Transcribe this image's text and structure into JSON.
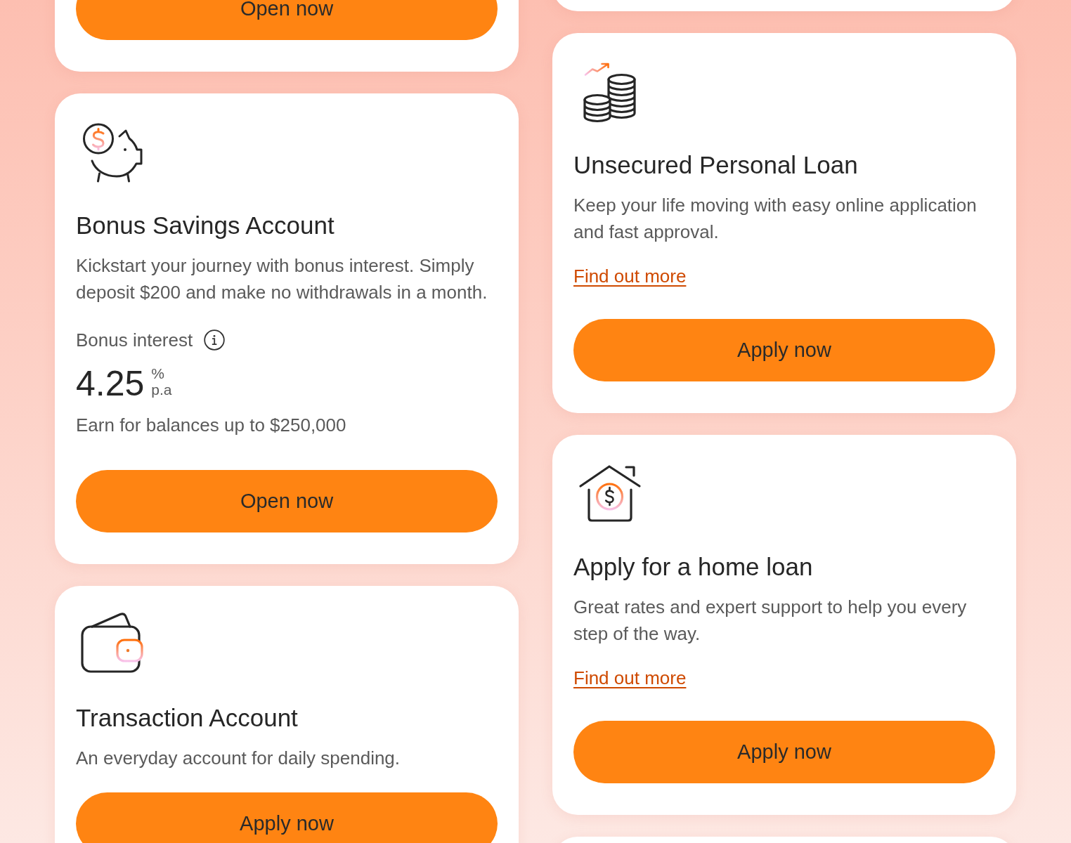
{
  "columns": [
    {
      "cards": [
        {
          "kind": "clipped",
          "button": "Open now"
        },
        {
          "kind": "product",
          "title": "Bonus Savings Account",
          "description": "Kickstart your journey with bonus interest. Simply deposit $200 and make no withdrawals in a month.",
          "rate": {
            "label": "Bonus interest",
            "value": "4.25",
            "unit": "%",
            "period": "p.a",
            "note": "Earn for balances up to $250,000"
          },
          "button": "Open now"
        },
        {
          "kind": "product",
          "title": "Transaction Account",
          "description": "An everyday account for daily spending.",
          "button": "Apply now"
        }
      ]
    },
    {
      "cards": [
        {
          "kind": "clipped"
        },
        {
          "kind": "product",
          "title": "Unsecured Personal Loan",
          "description": "Keep your life moving with easy online application and fast approval.",
          "link": "Find out more",
          "button": "Apply now"
        },
        {
          "kind": "product",
          "title": "Apply for a home loan",
          "description": "Great rates and expert support to help you every step of the way.",
          "link": "Find out more",
          "button": "Apply now"
        },
        {
          "kind": "clipped"
        }
      ]
    }
  ]
}
